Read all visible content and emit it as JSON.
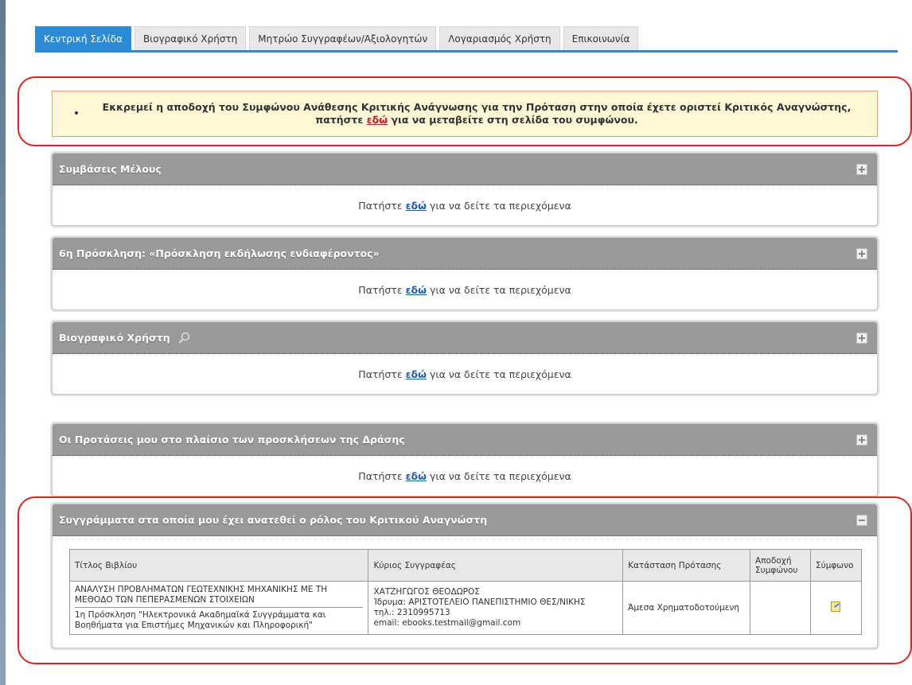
{
  "tabs": [
    {
      "label": "Κεντρική Σελίδα"
    },
    {
      "label": "Βιογραφικό Χρήστη"
    },
    {
      "label": "Μητρώο Συγγραφέων/Αξιολογητών"
    },
    {
      "label": "Λογαριασμός Χρήστη"
    },
    {
      "label": "Επικοινωνία"
    }
  ],
  "notice": {
    "bullet": "•",
    "text_before": "Εκκρεμεί η αποδοχή του Συμφώνου Ανάθεσης Κριτικής Ανάγνωσης για την Πρόταση στην οποία έχετε οριστεί Κριτικός Αναγνώστης, πατήστε ",
    "link": "εδώ",
    "text_after": " για να μεταβείτε στη σελίδα του συμφώνου."
  },
  "panels": [
    {
      "title": "Συμβάσεις Μέλους",
      "body_before": "Πατήστε",
      "link": "εδώ",
      "body_after": "για να δείτε τα περιεχόμενα"
    },
    {
      "title": "6η Πρόσκληση: «Πρόσκληση εκδήλωσης ενδιαφέροντος»",
      "body_before": "Πατήστε",
      "link": "εδώ",
      "body_after": "για να δείτε τα περιεχόμενα"
    },
    {
      "title": "Βιογραφικό Χρήστη",
      "body_before": "Πατήστε",
      "link": "εδώ",
      "body_after": "για να δείτε τα περιεχόμενα"
    },
    {
      "title": "Οι Προτάσεις μου στο πλαίσιο των προσκλήσεων της Δράσης",
      "body_before": "Πατήστε",
      "link": "εδώ",
      "body_after": "για να δείτε τα περιεχόμενα"
    }
  ],
  "books_panel": {
    "title": "Συγγράμματα στα οποία μου έχει ανατεθεί ο ρόλος του Κριτικού Αναγνώστη",
    "columns": [
      "Τίτλος Βιβλίου",
      "Κύριος Συγγραφέας",
      "Κατάσταση Πρότασης",
      "Αποδοχή Συμφώνου",
      "Σύμφωνο"
    ],
    "rows": [
      {
        "book_title": "ΑΝΑΛΥΣΗ ΠΡΟΒΛΗΜΑΤΩΝ ΓΕΩΤΕΧΝΙΚΗΣ ΜΗΧΑΝΙΚΗΣ ΜΕ ΤΗ ΜΕΘΟΔΟ ΤΩΝ ΠΕΠΕΡΑΣΜΕΝΩΝ ΣΤΟΙΧΕΙΩΝ",
        "call": "1η Πρόσκληση \"Ηλεκτρονικά Ακαδημαϊκά Συγγράμματα και Βοηθήματα για Επιστήμες Μηχανικών και Πληροφορική\"",
        "author_name": "ΧΑΤΖΗΓΩΓΟΣ ΘΕΟΔΩΡΟΣ",
        "author_institution": "Ίδρυμα: ΑΡΙΣΤΟΤΕΛΕΙΟ ΠΑΝΕΠΙΣΤΗΜΙΟ ΘΕΣ/ΝΙΚΗΣ",
        "author_phone": "τηλ.: 2310995713",
        "author_email": "email: ebooks.testmail@gmail.com",
        "status": "Άμεσα Χρηματοδοτούμενη",
        "acceptance": ""
      }
    ]
  }
}
